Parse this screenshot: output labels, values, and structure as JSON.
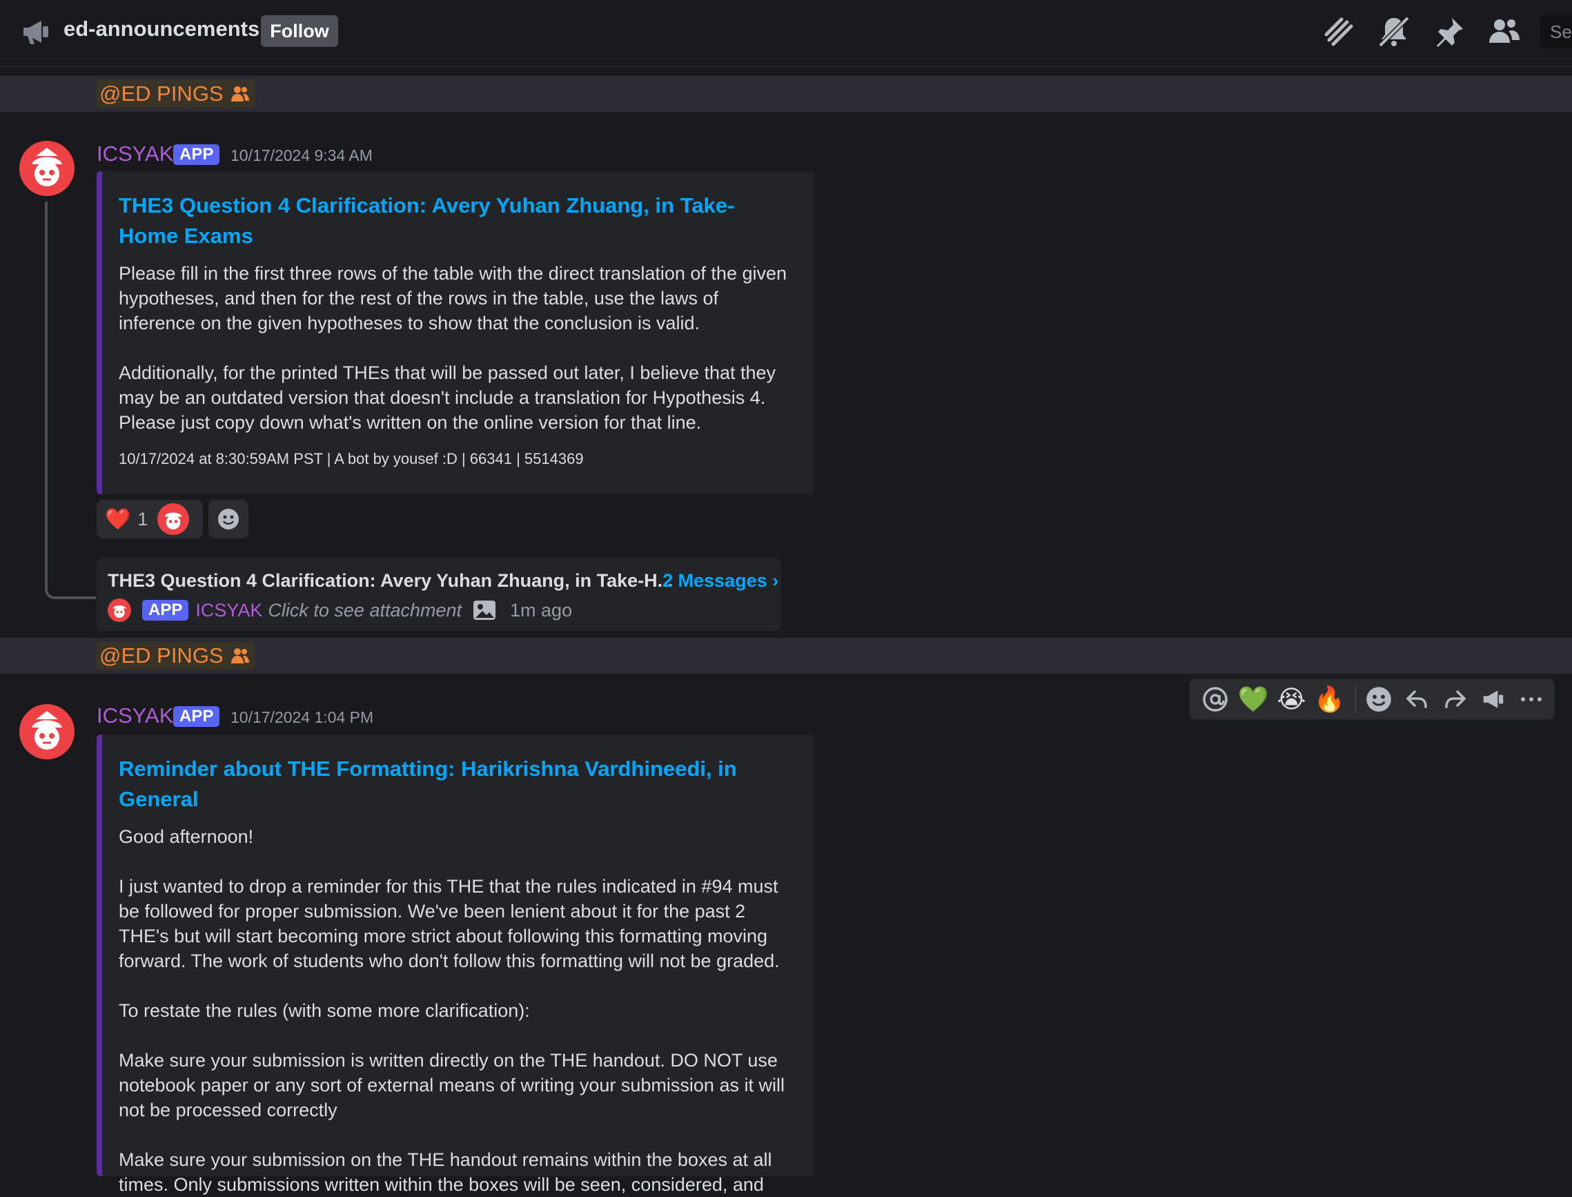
{
  "topbar": {
    "channel_name": "ed-announcements",
    "follow_label": "Follow",
    "search_placeholder": "Se"
  },
  "ping_label": "@ED PINGS",
  "messages": [
    {
      "author": "ICSYAK",
      "badge": "APP",
      "timestamp": "10/17/2024 9:34 AM",
      "embed": {
        "title": "THE3 Question 4 Clarification: Avery Yuhan Zhuang, in Take-Home Exams",
        "paragraphs": [
          "Please fill in the first three rows of the table with the direct translation of the given hypotheses, and then for the rest of the rows in the table, use the laws of inference on the given hypotheses to show that the conclusion is valid.",
          "Additionally, for the printed THEs that will be passed out later, I believe that they may be an outdated version that doesn't include a translation for Hypothesis 4. Please just copy down what's written on the online version for that line."
        ],
        "footer": "10/17/2024 at 8:30:59AM PST | A bot by yousef :D | 66341 | 5514369"
      },
      "reaction": {
        "emoji": "❤️",
        "count": "1"
      },
      "thread": {
        "title": "THE3 Question 4 Clarification: Avery Yuhan Zhuang, in Take-H...",
        "count_label": "2 Messages ›",
        "badge": "APP",
        "author": "ICSYAK",
        "preview": "Click to see attachment",
        "time": "1m ago"
      }
    },
    {
      "author": "ICSYAK",
      "badge": "APP",
      "timestamp": "10/17/2024 1:04 PM",
      "embed": {
        "title": "Reminder about THE Formatting: Harikrishna Vardhineedi, in General",
        "paragraphs": [
          "Good afternoon!",
          "I just wanted to drop a reminder for this THE that the rules indicated in #94 must be followed for proper submission. We've been lenient about it for the past 2 THE's but will start becoming more strict about following this formatting moving forward. The work of students who don't follow this formatting will not be graded.",
          "To restate the rules (with some more clarification):",
          "Make sure your submission is written directly on the THE handout. DO NOT use notebook paper or any sort of external means of writing your submission as it will not be processed correctly",
          "Make sure your submission on the THE handout remains within the boxes at all times. Only submissions written within the boxes will be seen, considered, and"
        ]
      }
    }
  ],
  "hover_toolbar": {
    "emojis": [
      "💚",
      "😭",
      "🔥"
    ]
  }
}
